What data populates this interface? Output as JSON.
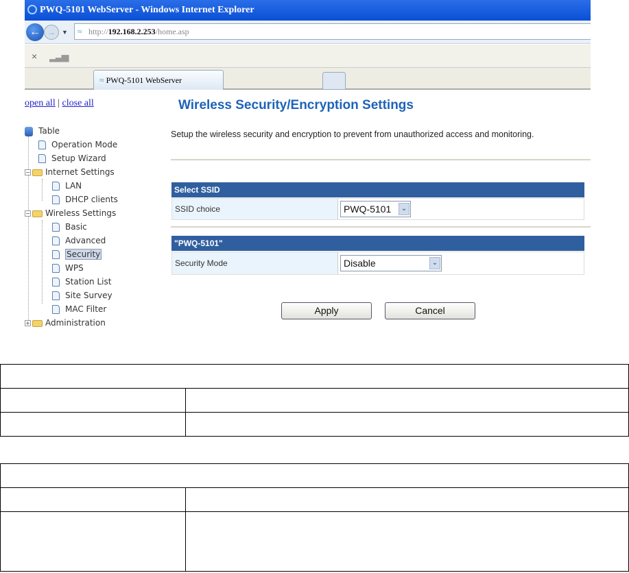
{
  "browser": {
    "window_title": "PWQ-5101 WebServer - Windows Internet Explorer",
    "address_prefix": "http://",
    "address_host": "192.168.2.253",
    "address_path": "/home.asp",
    "stop_label": "×",
    "tab_label": "PWQ-5101 WebServer"
  },
  "sidebar": {
    "open_all": "open all",
    "separator": "|",
    "close_all": "close all",
    "root": "Table",
    "items": [
      {
        "label": "Operation Mode"
      },
      {
        "label": "Setup Wizard"
      },
      {
        "label": "Internet Settings"
      },
      {
        "label": "LAN"
      },
      {
        "label": "DHCP clients"
      },
      {
        "label": "Wireless Settings"
      },
      {
        "label": "Basic"
      },
      {
        "label": "Advanced"
      },
      {
        "label": "Security"
      },
      {
        "label": "WPS"
      },
      {
        "label": "Station List"
      },
      {
        "label": "Site Survey"
      },
      {
        "label": "MAC Filter"
      },
      {
        "label": "Administration"
      }
    ]
  },
  "main": {
    "title": "Wireless Security/Encryption Settings",
    "description": "Setup the wireless security and encryption to prevent from unauthorized access and monitoring.",
    "ssid_section": {
      "header": "Select SSID",
      "label": "SSID choice",
      "value": "PWQ-5101"
    },
    "security_section": {
      "header": "\"PWQ-5101\"",
      "label": "Security Mode",
      "value": "Disable"
    },
    "apply_label": "Apply",
    "cancel_label": "Cancel"
  }
}
